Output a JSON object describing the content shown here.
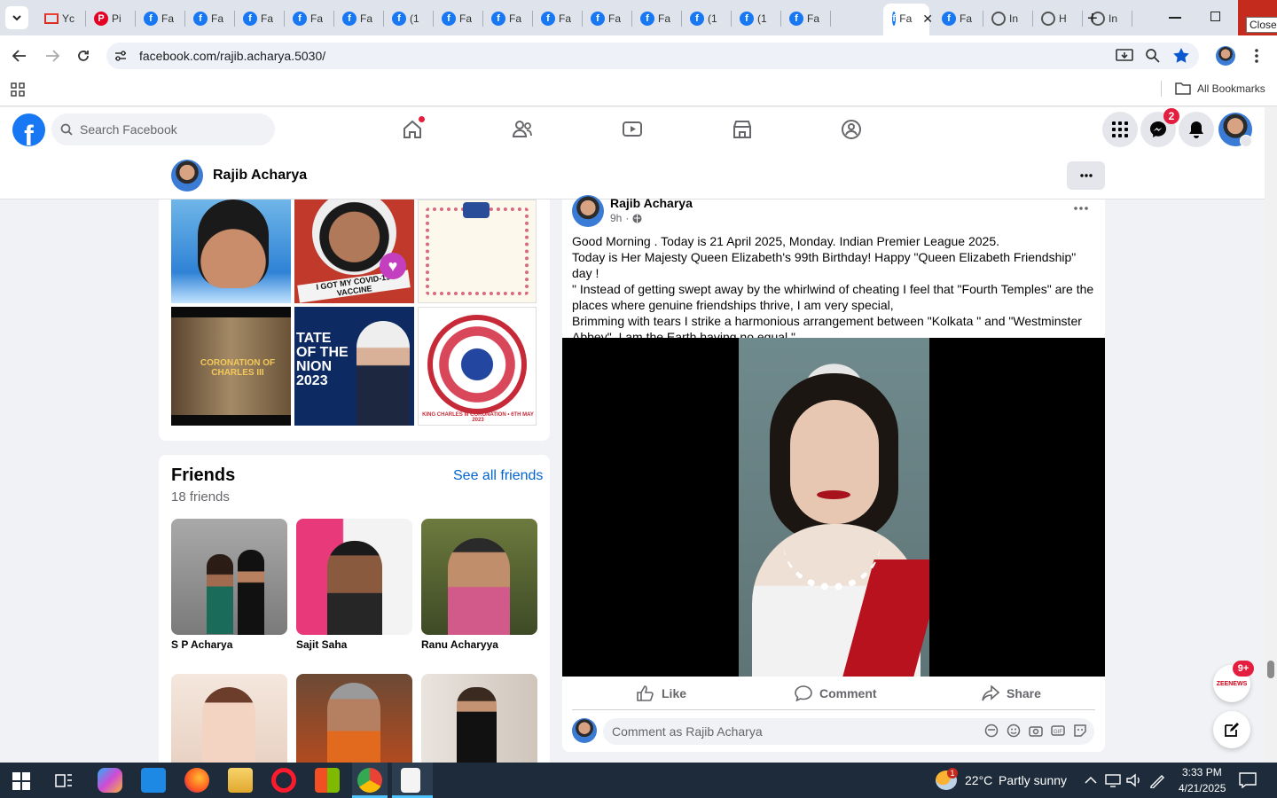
{
  "browser": {
    "tabs": [
      {
        "label": "Yc",
        "icon": "gmail-icon"
      },
      {
        "label": "Pi",
        "icon": "pinterest-icon"
      },
      {
        "label": "Fa",
        "icon": "facebook-icon"
      },
      {
        "label": "Fa",
        "icon": "facebook-icon"
      },
      {
        "label": "Fa",
        "icon": "facebook-icon"
      },
      {
        "label": "Fa",
        "icon": "facebook-icon"
      },
      {
        "label": "Fa",
        "icon": "facebook-icon"
      },
      {
        "label": "(1",
        "icon": "facebook-icon"
      },
      {
        "label": "Fa",
        "icon": "facebook-icon"
      },
      {
        "label": "Fa",
        "icon": "facebook-icon"
      },
      {
        "label": "Fa",
        "icon": "facebook-icon"
      },
      {
        "label": "Fa",
        "icon": "facebook-icon"
      },
      {
        "label": "Fa",
        "icon": "facebook-icon"
      },
      {
        "label": "(1",
        "icon": "facebook-icon"
      },
      {
        "label": "(1",
        "icon": "facebook-icon"
      },
      {
        "label": "Fa",
        "icon": "facebook-icon"
      },
      {
        "label": "Fa",
        "icon": "facebook-icon"
      },
      {
        "label": "Fa",
        "icon": "facebook-icon"
      },
      {
        "label": "In",
        "icon": "globe-icon"
      },
      {
        "label": "H",
        "icon": "globe-icon"
      },
      {
        "label": "In",
        "icon": "globe-icon"
      }
    ],
    "active_tab_label": "Fa",
    "close_tooltip": "Close",
    "url": "facebook.com/rajib.acharya.5030/",
    "all_bookmarks": "All Bookmarks"
  },
  "facebook": {
    "search_placeholder": "Search Facebook",
    "messenger_badge": "2",
    "profile_name": "Rajib Acharya",
    "brand_color": "#1877f2"
  },
  "photos": {
    "tiles": [
      {
        "caption": ""
      },
      {
        "caption": "I GOT MY COVID-19 VACCINE"
      },
      {
        "caption": ""
      },
      {
        "caption": "CORONATION OF CHARLES III"
      },
      {
        "caption": "TATE OF THE NION 2023"
      },
      {
        "caption": "KING CHARLES III CORONATION • 6TH MAY 2023"
      }
    ]
  },
  "friends": {
    "title": "Friends",
    "see_all": "See all friends",
    "count": "18 friends",
    "list": [
      {
        "name": "S P Acharya"
      },
      {
        "name": "Sajit Saha"
      },
      {
        "name": "Ranu Acharyya"
      },
      {
        "name": ""
      },
      {
        "name": ""
      },
      {
        "name": ""
      }
    ]
  },
  "post": {
    "author": "Rajib Acharya",
    "time": "9h",
    "lines": [
      "Good Morning . Today is 21 April 2025, Monday. Indian Premier League 2025.",
      "Today is Her Majesty Queen Elizabeth's 99th Birthday! Happy \"Queen Elizabeth Friendship\" day !",
      "\" Instead of getting swept away by the whirlwind of cheating I feel that \"Fourth Temples\" are the places where genuine friendships thrive, I am very special,",
      "Brimming with tears I strike a harmonious arrangement between \"Kolkata \" and \"Westminster Abbey\", I am the Earth having no equal.\""
    ],
    "like": "Like",
    "comment": "Comment",
    "share": "Share",
    "comment_placeholder": "Comment as Rajib Acharya",
    "news_badge": "9+",
    "news_label": "ZEENEWS"
  },
  "taskbar": {
    "weather_temp": "22°C",
    "weather_desc": "Partly sunny",
    "weather_badge": "1",
    "time": "3:33 PM",
    "date": "4/21/2025"
  }
}
